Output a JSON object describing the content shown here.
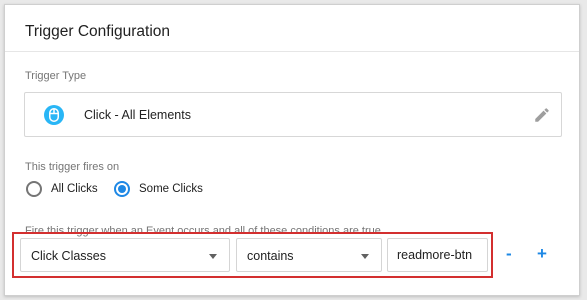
{
  "panel": {
    "title": "Trigger Configuration"
  },
  "trigger_type": {
    "section_label": "Trigger Type",
    "name": "Click - All Elements",
    "icon": "mouse-click-icon",
    "edit_icon": "pencil-icon",
    "icon_color": "#29b6f6"
  },
  "fires_on": {
    "section_label": "This trigger fires on",
    "options": [
      {
        "label": "All Clicks",
        "selected": false
      },
      {
        "label": "Some Clicks",
        "selected": true
      }
    ]
  },
  "conditions": {
    "section_label": "Fire this trigger when an Event occurs and all of these conditions are true",
    "variable": "Click Classes",
    "operator": "contains",
    "value": "readmore-btn",
    "remove_label": "-",
    "add_label": "+",
    "highlight_color": "#d32f2f"
  },
  "colors": {
    "accent": "#1e88e5"
  }
}
